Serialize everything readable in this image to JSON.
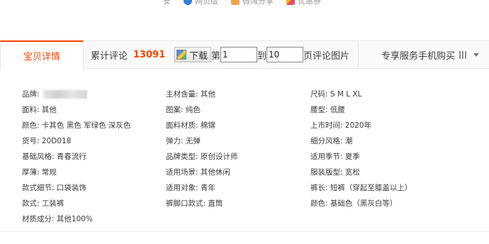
{
  "top_links": [
    {
      "label": "安",
      "icon": "orange-square-icon"
    },
    {
      "label": "网页版",
      "icon": "blue-circle-icon"
    },
    {
      "label": "微博分享",
      "icon": "orange-square-icon"
    },
    {
      "label": "优惠券",
      "icon": "multicolor-square-icon"
    }
  ],
  "tabs": {
    "details_label": "宝贝详情",
    "reviews_label": "累计评论",
    "reviews_count": "13091",
    "service_label": "专享服务手机购买"
  },
  "download": {
    "button_label": "下载",
    "from_label": "第",
    "from_value": "1",
    "to_label": "到",
    "to_value": "10",
    "suffix_label": "页评论图片"
  },
  "attributes": [
    [
      {
        "label": "品牌:",
        "value": "",
        "blurred": true
      },
      {
        "label": "主材含量:",
        "value": "其他"
      },
      {
        "label": "尺码:",
        "value": "S M L XL"
      }
    ],
    [
      {
        "label": "面料:",
        "value": "其他"
      },
      {
        "label": "图案:",
        "value": "纯色"
      },
      {
        "label": "腰型:",
        "value": "低腰"
      }
    ],
    [
      {
        "label": "颜色:",
        "value": "卡其色 黑色 军绿色 深灰色"
      },
      {
        "label": "面料材质:",
        "value": "棉锦"
      },
      {
        "label": "上市时间:",
        "value": "2020年"
      }
    ],
    [
      {
        "label": "货号:",
        "value": "20D018"
      },
      {
        "label": "弹力:",
        "value": "无弹"
      },
      {
        "label": "细分风格:",
        "value": "潮"
      }
    ],
    [
      {
        "label": "基础风格:",
        "value": "青春流行"
      },
      {
        "label": "品牌类型:",
        "value": "原创设计师"
      },
      {
        "label": "适用季节:",
        "value": "夏季"
      }
    ],
    [
      {
        "label": "厚薄:",
        "value": "常规"
      },
      {
        "label": "适用场景:",
        "value": "其他休闲"
      },
      {
        "label": "服装版型:",
        "value": "宽松"
      }
    ],
    [
      {
        "label": "款式细节:",
        "value": "口袋装饰"
      },
      {
        "label": "适用对象:",
        "value": "青年"
      },
      {
        "label": "裤长:",
        "value": "短裤（穿起至膝盖以上）"
      }
    ],
    [
      {
        "label": "款式:",
        "value": "工装裤"
      },
      {
        "label": "裤脚口款式:",
        "value": "直筒"
      },
      {
        "label": "颜色:",
        "value": "基础色（黑灰白等）"
      }
    ],
    [
      {
        "label": "材质成分:",
        "value": "其他100%"
      }
    ]
  ],
  "colors": {
    "accent": "#ff4400",
    "text": "#3c3c3c",
    "border": "#e6e6e6"
  }
}
